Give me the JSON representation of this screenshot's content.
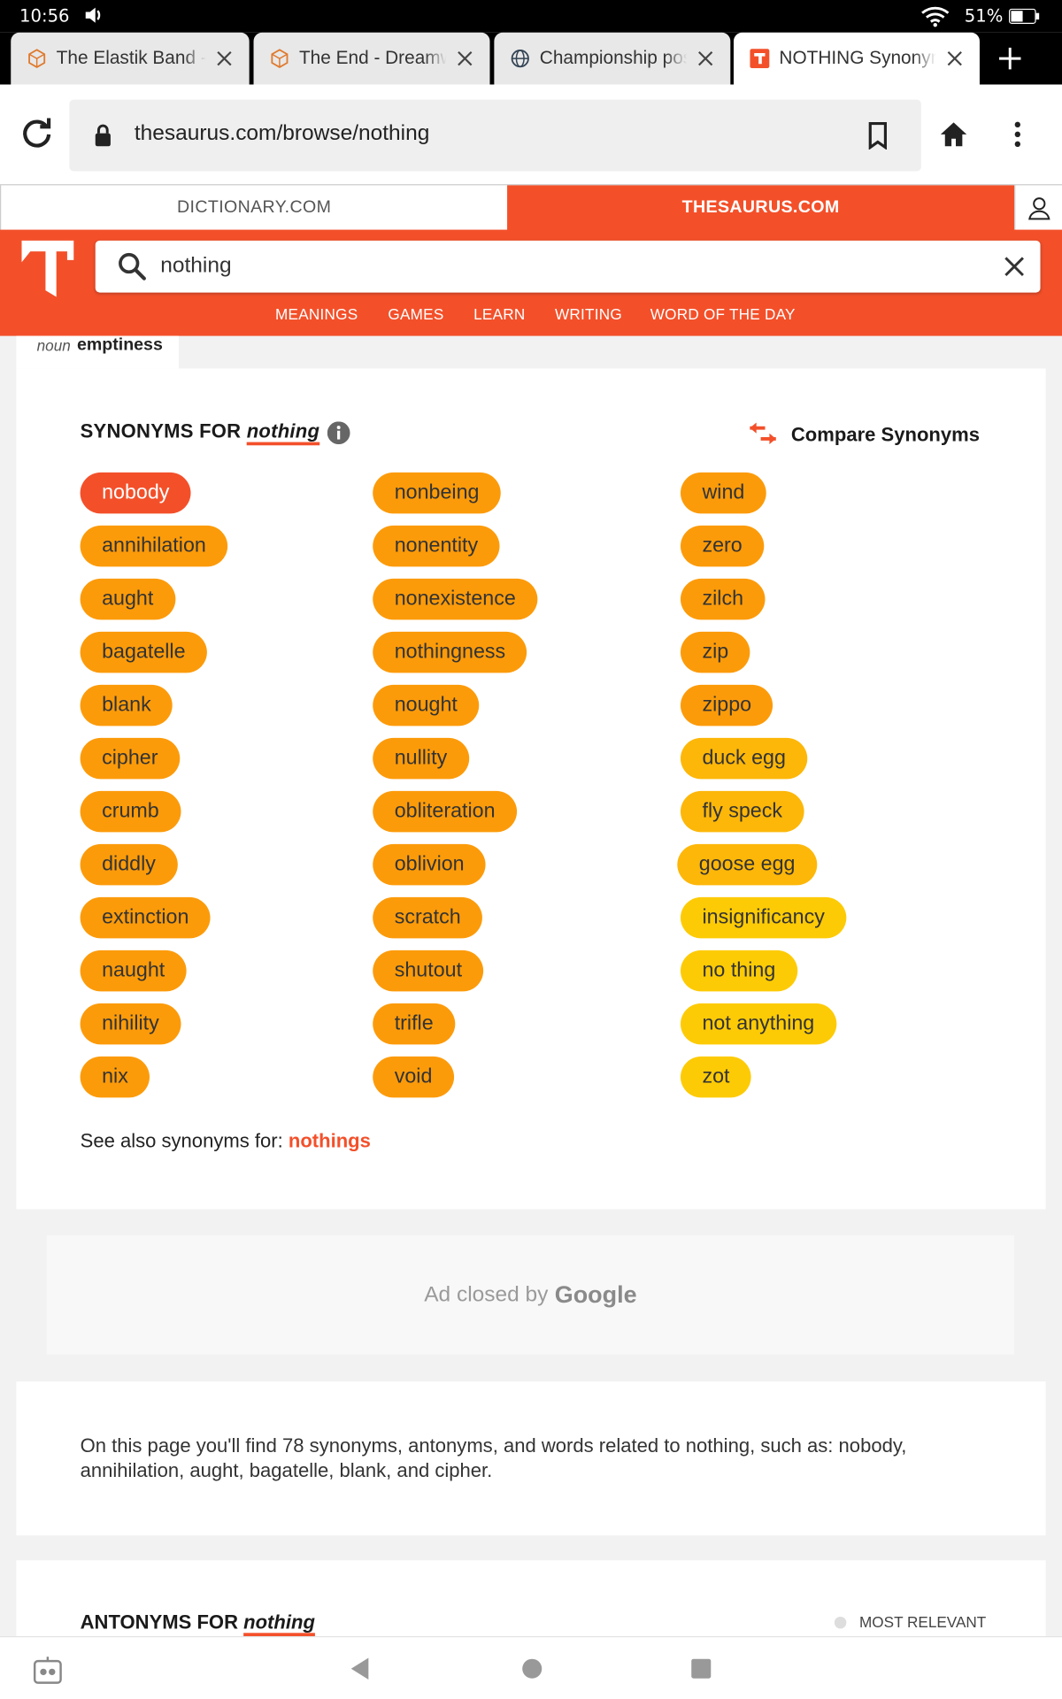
{
  "status": {
    "time": "10:56",
    "battery": "51%",
    "battery_level": 0.51
  },
  "tabs": [
    {
      "title": "The Elastik Band -",
      "favicon": "cube-icon"
    },
    {
      "title": "The End - Dreamwo",
      "favicon": "cube-icon"
    },
    {
      "title": "Championship pos",
      "favicon": "globe-icon"
    },
    {
      "title": "NOTHING Synonym",
      "favicon": "thesaurus-icon"
    }
  ],
  "address": {
    "url": "thesaurus.com/browse/nothing"
  },
  "site_switch": {
    "dictionary": "DICTIONARY.COM",
    "thesaurus": "THESAURUS.COM"
  },
  "search": {
    "value": "nothing"
  },
  "nav": {
    "meanings": "MEANINGS",
    "games": "GAMES",
    "learn": "LEARN",
    "writing": "WRITING",
    "wotd": "WORD OF THE DAY"
  },
  "sense": {
    "pos": "noun",
    "word": "emptiness"
  },
  "synonyms": {
    "heading_prefix": "SYNONYMS FOR",
    "headword": "nothing",
    "compare_label": "Compare Synonyms",
    "columns": [
      [
        "nobody",
        "annihilation",
        "aught",
        "bagatelle",
        "blank",
        "cipher",
        "crumb",
        "diddly",
        "extinction",
        "naught",
        "nihility",
        "nix"
      ],
      [
        "nonbeing",
        "nonentity",
        "nonexistence",
        "nothingness",
        "nought",
        "nullity",
        "obliteration",
        "oblivion",
        "scratch",
        "shutout",
        "trifle",
        "void"
      ],
      [
        "wind",
        "zero",
        "zilch",
        "zip",
        "zippo",
        "duck egg",
        "fly speck",
        "goose egg",
        "insignificancy",
        "no thing",
        "not anything",
        "zot"
      ]
    ],
    "see_also_prefix": "See also synonyms for:",
    "see_also_link": "nothings"
  },
  "ad": {
    "text": "Ad closed by",
    "brand": "Google"
  },
  "summary": "On this page you'll find 78 synonyms, antonyms, and words related to nothing, such as: nobody, annihilation, aught, bagatelle, blank, and cipher.",
  "antonyms": {
    "heading_prefix": "ANTONYMS FOR",
    "headword": "nothing",
    "sort_label": "MOST RELEVANT"
  },
  "colors": {
    "brand": "#f3502a",
    "chip_red": "#f3502a",
    "chip_orange": "#fc9b0a",
    "chip_amber": "#fdb709",
    "chip_yellow": "#fdcb06"
  }
}
